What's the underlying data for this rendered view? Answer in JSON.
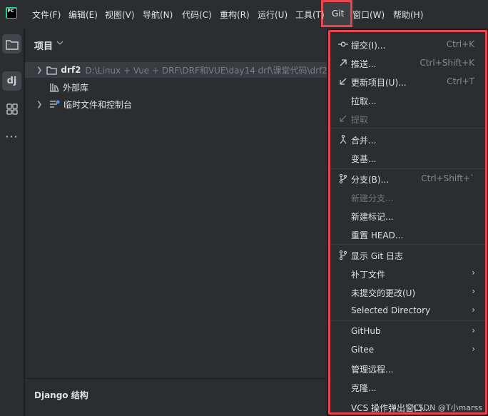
{
  "menu": {
    "logo_text": "PC",
    "items": [
      {
        "label": "文件(F)"
      },
      {
        "label": "编辑(E)"
      },
      {
        "label": "视图(V)"
      },
      {
        "label": "导航(N)"
      },
      {
        "label": "代码(C)"
      },
      {
        "label": "重构(R)"
      },
      {
        "label": "运行(U)"
      },
      {
        "label": "工具(T)"
      },
      {
        "label": "Git"
      },
      {
        "label": "窗口(W)"
      },
      {
        "label": "帮助(H)"
      }
    ]
  },
  "project_panel": {
    "title": "项目",
    "tree": [
      {
        "name": "drf2",
        "path": "D:\\Linux + Vue + DRF\\DRF和VUE\\day14 drf\\课堂代码\\drf2"
      },
      {
        "name": "外部库"
      },
      {
        "name": "临时文件和控制台"
      }
    ]
  },
  "bottom_panel": {
    "title": "Django 结构"
  },
  "git_menu": {
    "items": [
      {
        "label": "提交(I)...",
        "shortcut": "Ctrl+K",
        "icon": "commit-icon"
      },
      {
        "label": "推送...",
        "shortcut": "Ctrl+Shift+K",
        "icon": "push-icon"
      },
      {
        "label": "更新项目(U)...",
        "shortcut": "Ctrl+T",
        "icon": "update-icon"
      },
      {
        "label": "拉取..."
      },
      {
        "label": "提取",
        "icon": "fetch-icon",
        "disabled": true
      },
      {
        "label": "合并...",
        "icon": "merge-icon"
      },
      {
        "label": "变基..."
      },
      {
        "label": "分支(B)...",
        "shortcut": "Ctrl+Shift+`",
        "icon": "branch-icon"
      },
      {
        "label": "新建分支...",
        "disabled": true
      },
      {
        "label": "新建标记..."
      },
      {
        "label": "重置 HEAD..."
      },
      {
        "label": "显示 Git 日志",
        "icon": "git-log-icon"
      },
      {
        "label": "补丁文件",
        "submenu": true
      },
      {
        "label": "未提交的更改(U)",
        "submenu": true
      },
      {
        "label": "Selected Directory",
        "submenu": true
      },
      {
        "label": "GitHub",
        "submenu": true
      },
      {
        "label": "Gitee",
        "submenu": true
      },
      {
        "label": "管理远程..."
      },
      {
        "label": "克隆..."
      },
      {
        "label": "VCS 操作弹出窗口..."
      }
    ],
    "watermark": "CSDN @T小marss"
  },
  "colors": {
    "highlight": "#e8454d",
    "accent": "#21d789"
  }
}
